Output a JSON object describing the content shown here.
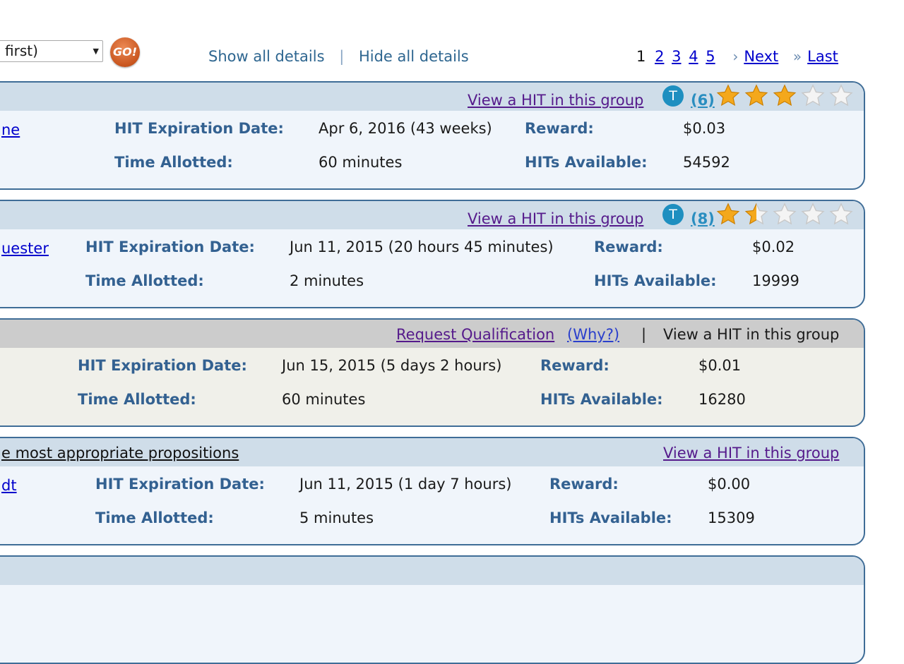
{
  "toolbar": {
    "sort_selected": "first)",
    "go_label": "GO!",
    "show_all": "Show all details",
    "separator": "|",
    "hide_all": "Hide all details"
  },
  "pager": {
    "current": "1",
    "pages": [
      "2",
      "3",
      "4",
      "5"
    ],
    "next_label": "Next",
    "last_label": "Last"
  },
  "labels": {
    "expiration": "HIT Expiration Date:",
    "reward": "Reward:",
    "time": "Time Allotted:",
    "available": "HITs Available:"
  },
  "hits": [
    {
      "title_fragment": "",
      "requester_fragment": "ne",
      "action": "View a HIT in this group",
      "turkopticon_badge": "T",
      "review_count": "(6)",
      "rating_stars": 3,
      "expiration": "Apr 6, 2016  (43 weeks)",
      "reward": "$0.03",
      "time": "60 minutes",
      "available": "54592"
    },
    {
      "title_fragment": "",
      "requester_fragment": "uester",
      "action": "View a HIT in this group",
      "turkopticon_badge": "T",
      "review_count": "(8)",
      "rating_stars": 1.5,
      "expiration": "Jun 11, 2015  (20 hours 45 minutes)",
      "reward": "$0.02",
      "time": "2 minutes",
      "available": "19999"
    },
    {
      "title_fragment": "",
      "requester_fragment": "",
      "request_qualification": "Request Qualification",
      "why": "(Why?)",
      "separator": "|",
      "action": "View a HIT in this group",
      "expiration": "Jun 15, 2015  (5 days 2 hours)",
      "reward": "$0.01",
      "time": "60 minutes",
      "available": "16280"
    },
    {
      "title_fragment": "e most appropriate propositions",
      "requester_fragment": "dt",
      "action": "View a HIT in this group",
      "expiration": "Jun 11, 2015  (1 day 7 hours)",
      "reward": "$0.00",
      "time": "5 minutes",
      "available": "15309"
    }
  ],
  "colors": {
    "label_blue": "#336191",
    "header_bar": "#cfdde9",
    "qual_bar": "#cccccc",
    "border": "#3f6d97",
    "star_gold": "#f4a81c"
  }
}
